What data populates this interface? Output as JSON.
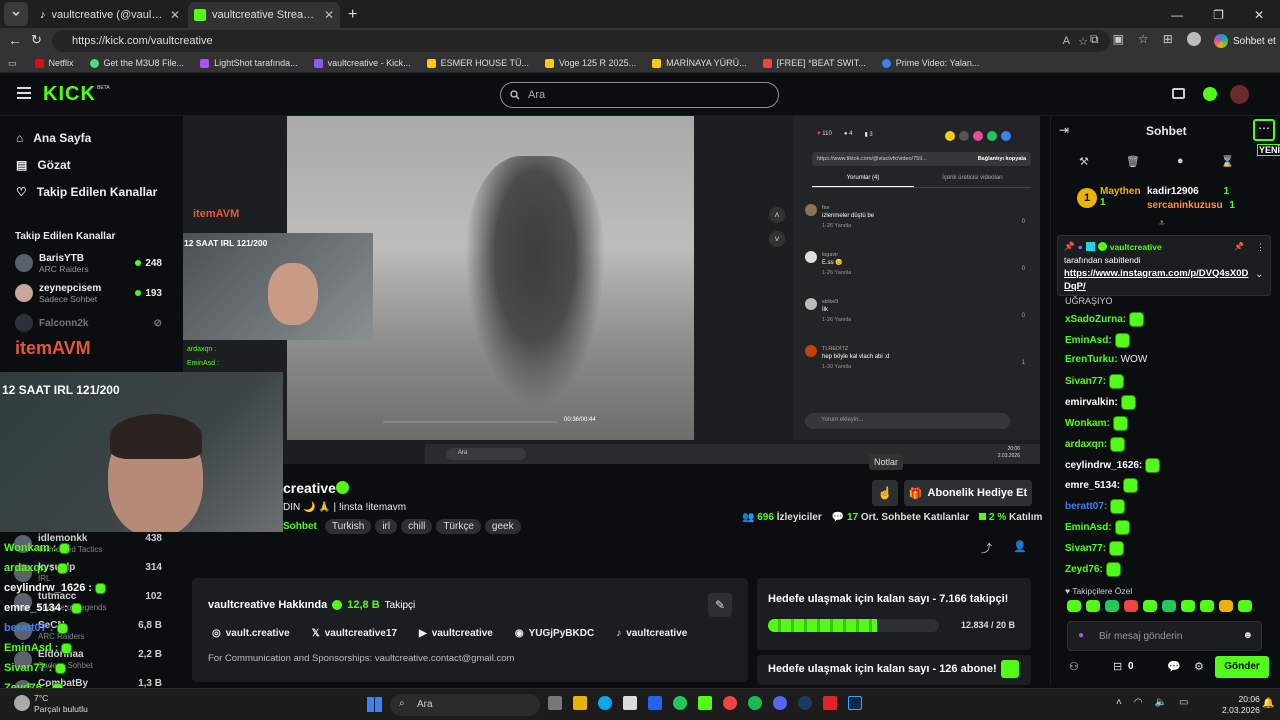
{
  "browser": {
    "tabs": [
      {
        "title": "vaultcreative (@vaultcreative)"
      },
      {
        "title": "vaultcreative Stream - Watch Live"
      }
    ],
    "url": "https://kick.com/vaultcreative",
    "profile_label": "Sohbet et",
    "bookmarks": [
      "Netflix",
      "Get the M3U8 File...",
      "LightShot tarafında...",
      "vaultcreative - Kick...",
      "ESMER HOUSE TÜ...",
      "Voge 125 R 2025...",
      "MARİNAYA YÜRÜ...",
      "[FREE] *BEAT SWIT...",
      "Prime Video: Yalan..."
    ]
  },
  "header": {
    "logo": "KICK",
    "beta": "BETA",
    "search_placeholder": "Ara"
  },
  "sidebar": {
    "nav": [
      {
        "label": "Ana Sayfa"
      },
      {
        "label": "Gözat"
      },
      {
        "label": "Takip Edilen Kanallar"
      }
    ],
    "section_title": "Takip Edilen Kanallar",
    "channels": [
      {
        "name": "BarisYTB",
        "sub": "ARC Raiders",
        "count": "248"
      },
      {
        "name": "zeynepcisem",
        "sub": "Sadece Sohbet",
        "count": "193"
      },
      {
        "name": "Falconn2k",
        "sub": "",
        "count": ""
      }
    ],
    "overlay_channels": [
      {
        "name": "idlemonkk",
        "sub": "Tormented Tactics",
        "count": "438"
      },
      {
        "name": "kysuelp",
        "sub": "IRL",
        "count": "314"
      },
      {
        "name": "tutmacc",
        "sub": "League of Legends",
        "count": "102"
      },
      {
        "name": "SeCN",
        "sub": "ARC Raiders",
        "count": "6,8 B"
      },
      {
        "name": "Eldorinaa",
        "sub": "Sadece Sohbet",
        "count": "2,2 B"
      },
      {
        "name": "CombatBy",
        "sub": "",
        "count": "1,3 B"
      }
    ]
  },
  "player": {
    "brand": "itemAVM",
    "overlay_title": "12 SAAT IRL 121/200",
    "mini_chat": [
      "ardaxqn :",
      "EminAsd :"
    ],
    "video_time": "00:36/00:44",
    "tiktok": {
      "count_likes": "110",
      "count_b": "4",
      "count_c": "3",
      "link": "https://www.tiktok.com/@vlactvfx/video/759...",
      "copy_label": "Bağlantıyı kopyala",
      "tab_comments": "Yorumlar (4)",
      "tab_creator": "İçerik üreticisi videoları",
      "comments": [
        {
          "user": "fav",
          "text": "izlenmeler düştü be",
          "meta": "1-26   Yanıtla",
          "likes": "0"
        },
        {
          "user": "logavir",
          "text": "E.ss 😊",
          "meta": "1-26   Yanıtla",
          "likes": "0"
        },
        {
          "user": "strike9",
          "text": "İlk",
          "meta": "1-26   Yanıtla",
          "likes": "0"
        },
        {
          "user": "TLREDİTZ",
          "text": "hep böyle kal vlach abi :d",
          "meta": "1-30   Yanıtla",
          "likes": "1"
        }
      ],
      "comment_placeholder": "Yorum ekleyin...",
      "taskbar_search": "Ara",
      "taskbar_time": "20:06",
      "taskbar_date": "2.03.2026"
    }
  },
  "webcam": {
    "title": "12 SAAT IRL 121/200"
  },
  "webcam_chat": [
    {
      "user": "Wonkam :",
      "color": "#53fc18"
    },
    {
      "user": "ardaxqn :",
      "color": "#53fc18"
    },
    {
      "user": "ceylindrw_1626 :",
      "color": "#ffffff"
    },
    {
      "user": "emre_5134 :",
      "color": "#ffffff"
    },
    {
      "user": "beratt07 :",
      "color": "#3b82f6"
    },
    {
      "user": "EminAsd :",
      "color": "#53fc18"
    },
    {
      "user": "Sivan77 :",
      "color": "#53fc18"
    },
    {
      "user": "Zeyd76 :",
      "color": "#53fc18"
    }
  ],
  "stream": {
    "channel_partial": "creative",
    "desc_partial": "DIN 🌙 🙏  | !insta !itemavm",
    "tags": [
      "Sohbet",
      "Turkish",
      "irl",
      "chill",
      "Türkçe",
      "geek"
    ],
    "tooltip": "Notlar",
    "gift_button": "Abonelik Hediye Et",
    "viewers": "696",
    "viewers_label": "İzleyiciler",
    "avg_chat": "17",
    "avg_chat_label": "Ort. Sohbete Katılanlar",
    "participation": "2 %",
    "participation_label": "Katılım"
  },
  "about": {
    "title": "vaultcreative Hakkında",
    "followers": "12,8 B",
    "followers_label": "Takipçi",
    "socials": [
      {
        "icon": "instagram-icon",
        "label": "vault.creative"
      },
      {
        "icon": "x-icon",
        "label": "vaultcreative17"
      },
      {
        "icon": "youtube-icon",
        "label": "vaultcreative"
      },
      {
        "icon": "discord-icon",
        "label": "YUGjPyBKDC"
      },
      {
        "icon": "tiktok-icon",
        "label": "vaultcreative"
      }
    ],
    "bio": "For Communication and Sponsorships: vaultcreative.contact@gmail.com"
  },
  "goals": {
    "follow_title": "Hedefe ulaşmak için kalan sayı - 7.166 takipçi!",
    "follow_progress": "12.834 / 20 B",
    "follow_fraction": 0.64,
    "sub_title": "Hedefe ulaşmak için kalan sayı - 126 abone!"
  },
  "chat": {
    "title": "Sohbet",
    "new_label": "YENİ",
    "leaders": [
      {
        "name": "Maythen",
        "count": "1"
      },
      {
        "name": "kadir12906",
        "count": "1"
      },
      {
        "name": "sercaninkuzusu",
        "count": "1"
      }
    ],
    "pinned": {
      "user": "vaultcreative",
      "by": "tarafından sabitlendi",
      "link": "https://www.instagram.com/p/DVQ4sX0DDqP/"
    },
    "partial": "UĞRAŞIYO",
    "messages": [
      {
        "user": "xSadoZurna:",
        "text": "",
        "emote": true,
        "color": "#53fc18"
      },
      {
        "user": "EminAsd:",
        "text": "",
        "emote": true,
        "color": "#53fc18"
      },
      {
        "user": "ErenTurku:",
        "text": "WOW",
        "emote": false,
        "color": "#53fc18"
      },
      {
        "user": "Sivan77:",
        "text": "",
        "emote": true,
        "color": "#53fc18"
      },
      {
        "user": "emirvalkin:",
        "text": "",
        "emote": true,
        "color": "#ffffff"
      },
      {
        "user": "Wonkam:",
        "text": "",
        "emote": true,
        "color": "#53fc18"
      },
      {
        "user": "ardaxqn:",
        "text": "",
        "emote": true,
        "color": "#53fc18"
      },
      {
        "user": "ceylindrw_1626:",
        "text": "",
        "emote": true,
        "color": "#ffffff"
      },
      {
        "user": "emre_5134:",
        "text": "",
        "emote": true,
        "color": "#ffffff"
      },
      {
        "user": "beratt07:",
        "text": "",
        "emote": true,
        "color": "#3b82f6"
      },
      {
        "user": "EminAsd:",
        "text": "",
        "emote": true,
        "color": "#53fc18"
      },
      {
        "user": "Sivan77:",
        "text": "",
        "emote": true,
        "color": "#53fc18"
      },
      {
        "user": "Zeyd76:",
        "text": "",
        "emote": true,
        "color": "#53fc18"
      }
    ],
    "follower_emotes_label": "Takipçilere Özel",
    "input_placeholder": "Bir mesaj gönderin",
    "points": "0",
    "send_label": "Gönder"
  },
  "windows": {
    "weather_temp": "7°C",
    "weather_text": "Parçalı bulutlu",
    "search": "Ara",
    "time": "20:06",
    "date": "2.03.2026"
  },
  "colors": {
    "kick_green": "#53fc18",
    "bg": "#0b0e0f",
    "panel": "#1b1e20"
  }
}
